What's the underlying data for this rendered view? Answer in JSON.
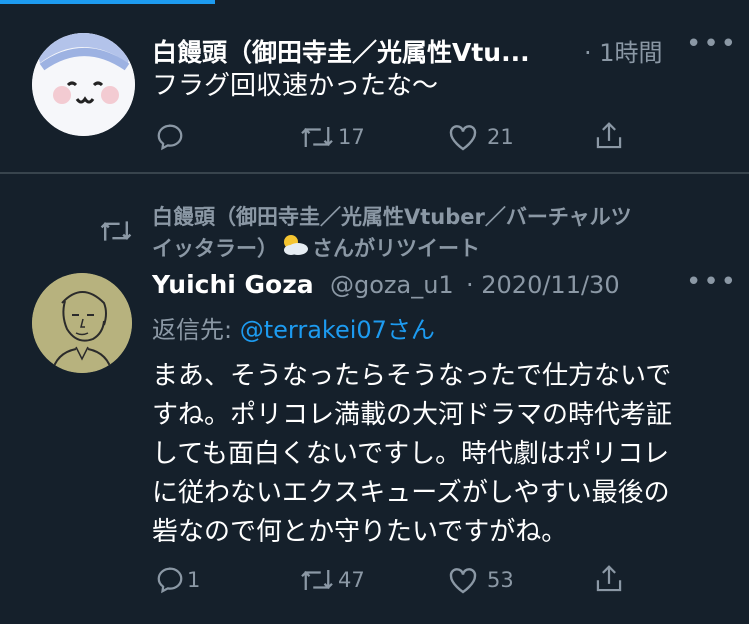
{
  "tweet1": {
    "name": "白饅頭（御田寺圭／光属性Vtu...",
    "time": "· 1時間",
    "text": "フラグ回収速かったな〜",
    "reply_count": "",
    "retweet_count": "17",
    "like_count": "21"
  },
  "tweet2": {
    "retweet_line_1": "白饅頭（御田寺圭／光属性Vtuber／バーチャルツ",
    "retweet_line_2a": "イッタラー）",
    "retweet_line_2b": "さんがリツイート",
    "name": "Yuichi Goza",
    "handle": "@goza_u1",
    "date": "· 2020/11/30",
    "reply_prefix": "返信先: ",
    "reply_handle": "@terrakei07さん",
    "text_lines": [
      "まあ、そうなったらそうなったで仕方ないで",
      "すね。ポリコレ満載の大河ドラマの時代考証",
      "しても面白くないですし。時代劇はポリコレ",
      "に従わないエクスキューズがしやすい最後の",
      "砦なので何とか守りたいですがね。"
    ],
    "reply_count": "1",
    "retweet_count": "47",
    "like_count": "53"
  },
  "colors": {
    "background": "#15202b",
    "muted": "#8b98a5",
    "accent": "#1d9bf0"
  },
  "icons": [
    "reply-icon",
    "retweet-icon",
    "like-icon",
    "share-icon",
    "more-icon",
    "sun-cloud-emoji"
  ]
}
